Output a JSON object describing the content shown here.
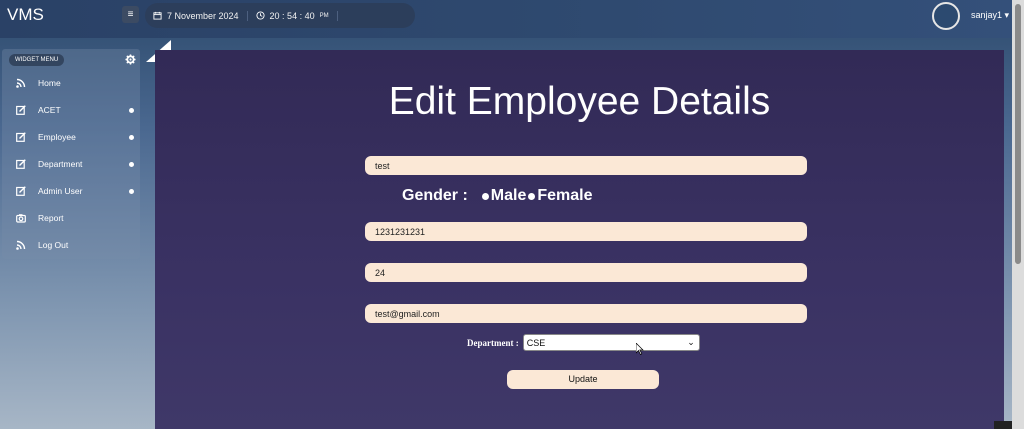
{
  "app": {
    "brand": "VMS"
  },
  "header": {
    "date": "7 November 2024",
    "time": "20 : 54 : 40",
    "time_suffix": "PM",
    "user": "sanjay1"
  },
  "sidebar": {
    "widget_label": "WIDGET MENU",
    "items": [
      {
        "label": "Home",
        "icon": "rss-icon",
        "has_dot": false
      },
      {
        "label": "ACET",
        "icon": "edit-icon",
        "has_dot": true
      },
      {
        "label": "Employee",
        "icon": "edit-icon",
        "has_dot": true
      },
      {
        "label": "Department",
        "icon": "edit-icon",
        "has_dot": true
      },
      {
        "label": "Admin User",
        "icon": "edit-icon",
        "has_dot": true
      },
      {
        "label": "Report",
        "icon": "camera-icon",
        "has_dot": false
      },
      {
        "label": "Log Out",
        "icon": "rss-icon",
        "has_dot": false
      }
    ]
  },
  "form": {
    "title": "Edit Employee Details",
    "name_value": "test",
    "gender_label": "Gender :",
    "gender_options": [
      "Male",
      "Female"
    ],
    "phone_value": "1231231231",
    "age_value": "24",
    "email_value": "test@gmail.com",
    "department_label": "Department :",
    "department_value": "CSE",
    "update_label": "Update"
  },
  "colors": {
    "panel": "#362e5d",
    "field_bg": "#fbe8d6",
    "topbar": "#2f4a70"
  }
}
